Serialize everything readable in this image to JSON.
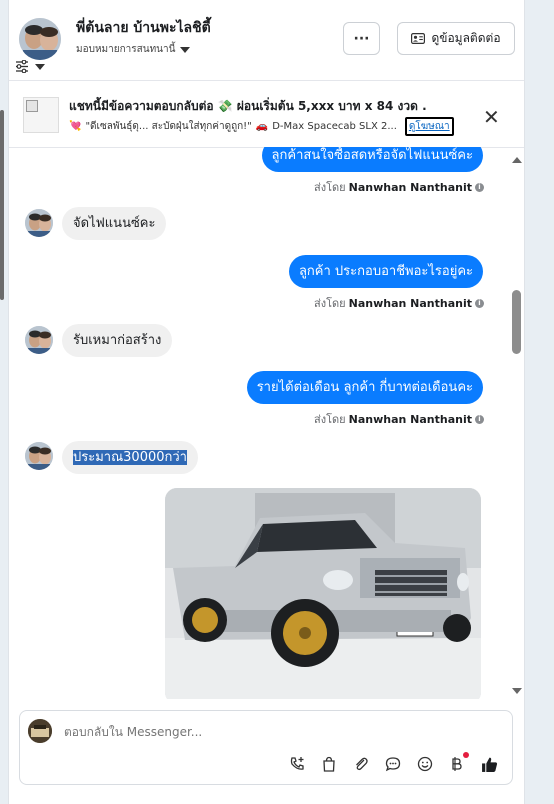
{
  "header": {
    "name": "พี่ต้นลาย บ้านพะไลชิตี้",
    "assign_label": "มอบหมายการสนทนานี้",
    "more_label": "···",
    "contact_label": "ดูข้อมูลติดต่อ"
  },
  "ad": {
    "title": "แชทนี้มีข้อความตอบกลับต่อ 💸 ผ่อนเริ่มต้น 5,xxx บาท x 84 งวด .",
    "subtitle_emoji": "💘",
    "subtitle_text": "\"ดีเซลพันธุ์ดุ... สะบัดฝุ่นใส่ทุกค่าดูถูก!\"",
    "car_emoji": "🚗",
    "model_text": "D-Max Spacecab SLX 2...",
    "link_label": "ดูโฆษณา"
  },
  "messages": [
    {
      "type": "out",
      "text": "ลูกค้าสนใจซื้อสดหรือจัดไฟแนนซ์คะ"
    },
    {
      "type": "sentby",
      "prefix": "ส่งโดย",
      "name": "Nanwhan Nanthanit"
    },
    {
      "type": "in",
      "text": "จัดไฟแนนซ์คะ"
    },
    {
      "type": "out",
      "text": "ลูกค้า ประกอบอาชีพอะไรอยู่คะ"
    },
    {
      "type": "sentby",
      "prefix": "ส่งโดย",
      "name": "Nanwhan Nanthanit"
    },
    {
      "type": "in",
      "text": "รับเหมาก่อสร้าง"
    },
    {
      "type": "out",
      "text": "รายได้ต่อเดือน ลูกค้า กี่บาทต่อเดือนคะ"
    },
    {
      "type": "sentby",
      "prefix": "ส่งโดย",
      "name": "Nanwhan Nanthanit"
    },
    {
      "type": "in",
      "text": "ประมาณ30000กว่า"
    }
  ],
  "truck_plate": "บร 8013",
  "composer": {
    "placeholder": "ตอบกลับใน Messenger..."
  },
  "colors": {
    "outgoing_bubble": "#0a7cff",
    "incoming_bubble": "#f0f0f0",
    "highlight": "#2f69b6"
  }
}
